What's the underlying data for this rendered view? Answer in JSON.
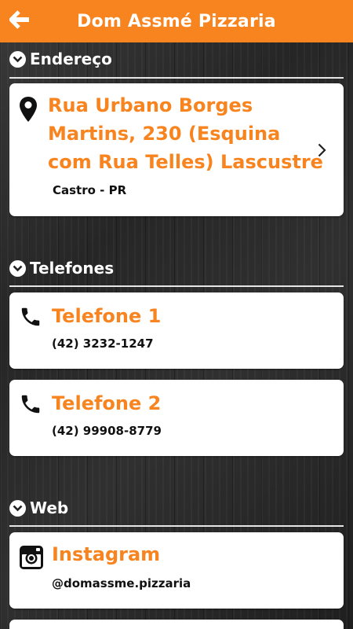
{
  "header": {
    "title": "Dom Assmé Pizzaria",
    "back_icon": "arrow-left-icon",
    "bg_color": "#f7841f"
  },
  "sections": {
    "address": {
      "label": "Endereço",
      "card": {
        "icon": "map-pin-icon",
        "line1": "Rua Urbano Borges",
        "line2": "Martins, 230 (Esquina",
        "line3": "com Rua Telles) Lascustre",
        "city": "Castro - PR",
        "chevron_icon": "chevron-right-icon"
      }
    },
    "phones": {
      "label": "Telefones",
      "items": [
        {
          "icon": "phone-icon",
          "title": "Telefone 1",
          "number": "(42) 3232-1247"
        },
        {
          "icon": "phone-icon",
          "title": "Telefone 2",
          "number": "(42) 99908-8779"
        }
      ]
    },
    "web": {
      "label": "Web",
      "items": [
        {
          "icon": "instagram-icon",
          "title": "Instagram",
          "handle": "@domassme.pizzaria"
        }
      ]
    }
  },
  "colors": {
    "accent": "#f7841f",
    "card_bg": "#ffffff",
    "text_dark": "#111111"
  }
}
